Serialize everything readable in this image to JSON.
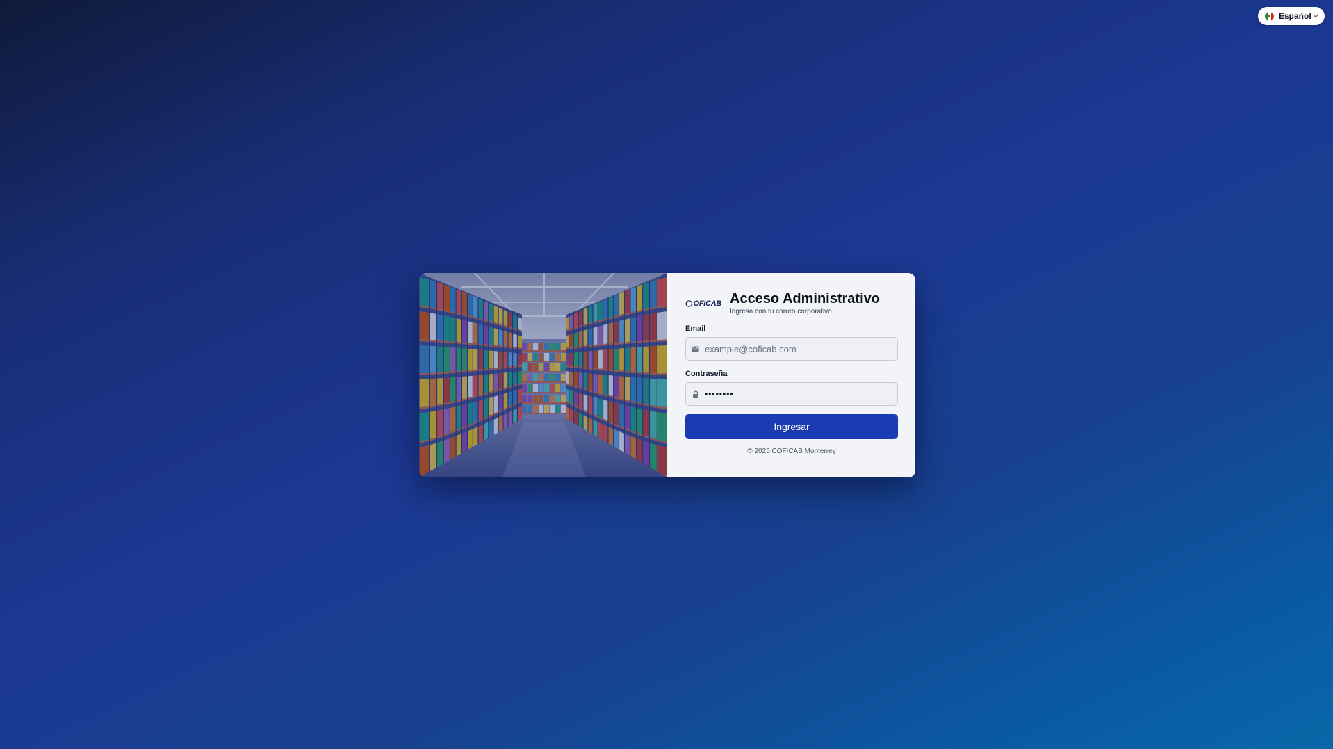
{
  "language_selector": {
    "label": "Español",
    "flag_icon": "mexico-flag-icon",
    "dropdown_icon": "chevron-down-icon"
  },
  "login": {
    "brand": {
      "logo_text": "OFICAB"
    },
    "title": "Acceso Administrativo",
    "subtitle": "Ingresa con tu correo corporativo",
    "email": {
      "label": "Email",
      "placeholder": "example@coficab.com",
      "value": "",
      "icon": "envelope-icon"
    },
    "password": {
      "label": "Contraseña",
      "value": "password",
      "icon": "lock-icon"
    },
    "submit_label": "Ingresar",
    "footer": "© 2025 COFICAB Monterrey"
  },
  "colors": {
    "primary_button": "#1b3bb3",
    "panel_background": "#f3f4f8",
    "page_gradient_start": "#0f1a3a",
    "page_gradient_end": "#0868a8"
  }
}
